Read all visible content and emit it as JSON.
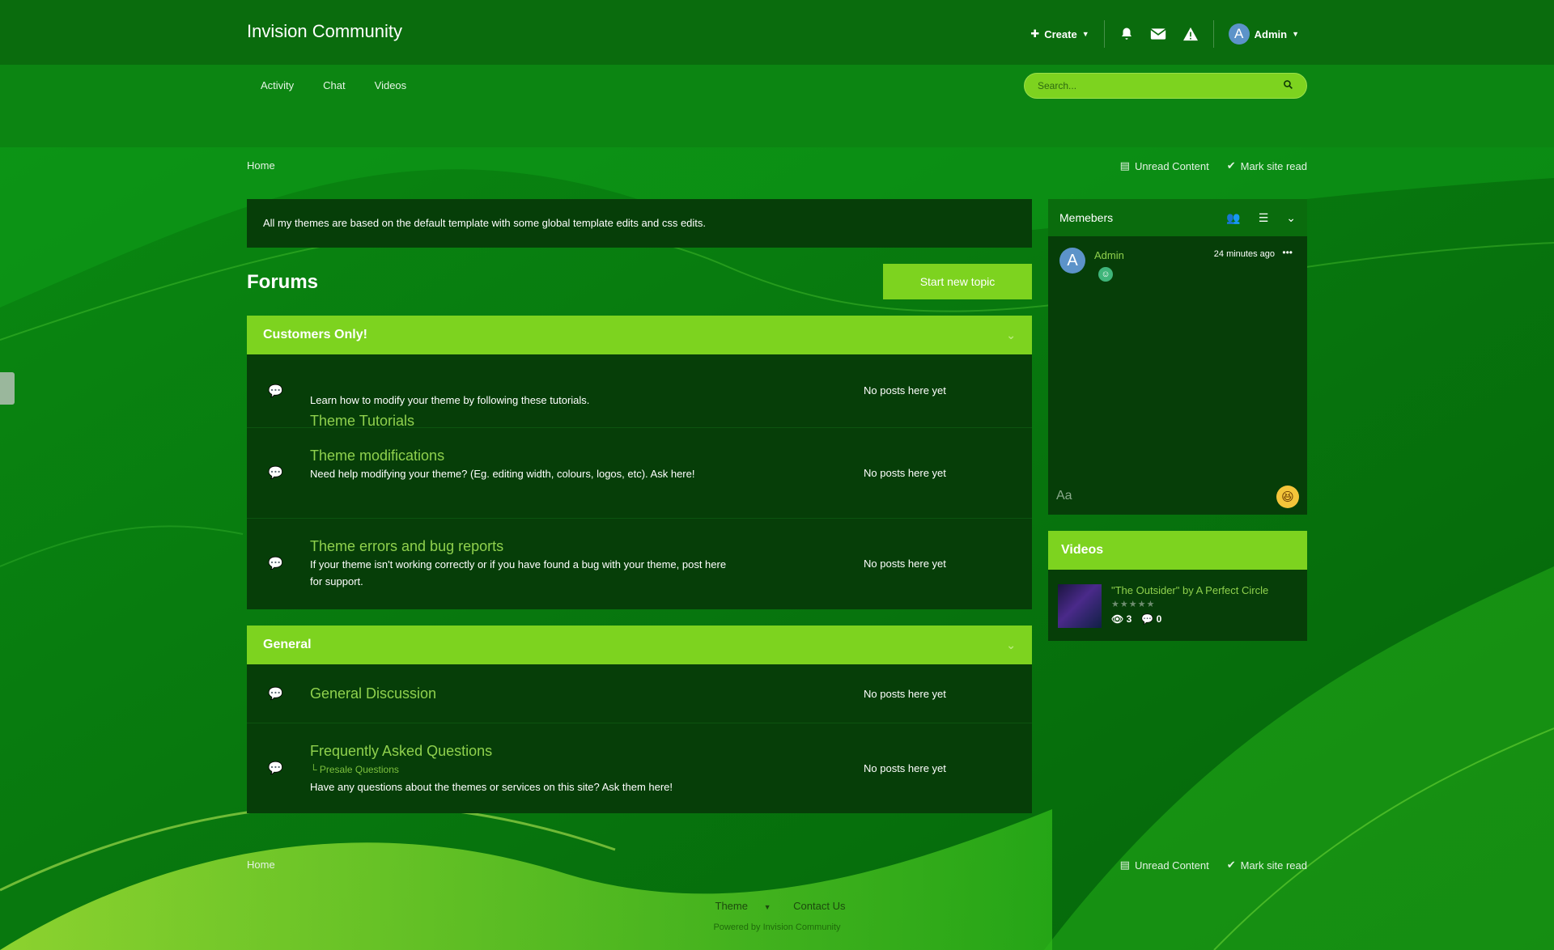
{
  "header": {
    "site_title": "Invision Community",
    "create_label": "Create",
    "user_name": "Admin",
    "avatar_letter": "A"
  },
  "nav": {
    "tabs": [
      {
        "label": "Activity"
      },
      {
        "label": "Chat"
      },
      {
        "label": "Videos"
      }
    ],
    "search_placeholder": "Search..."
  },
  "breadcrumb": {
    "home": "Home",
    "unread_content": "Unread Content",
    "mark_site_read": "Mark site read"
  },
  "announcement": "All my themes are based on the default template with some global template edits and css edits.",
  "main": {
    "page_title": "Forums",
    "start_topic_label": "Start new topic"
  },
  "categories": [
    {
      "name": "Customers Only!",
      "forums": [
        {
          "title": "Theme Tutorials",
          "desc": "Learn how to modify your theme by following these tutorials.",
          "last": "No posts here yet"
        },
        {
          "title": "Theme modifications",
          "desc": "Need help modifying your theme? (Eg. editing width, colours, logos, etc). Ask here!",
          "last": "No posts here yet"
        },
        {
          "title": "Theme errors and bug reports",
          "desc": "If your theme isn't working correctly or if you have found a bug with your theme, post here for support.",
          "last": "No posts here yet"
        }
      ]
    },
    {
      "name": "General",
      "forums": [
        {
          "title": "General Discussion",
          "last": "No posts here yet"
        },
        {
          "title": "Frequently Asked Questions",
          "sub": "Presale Questions",
          "desc": "Have any questions about the themes or services on this site? Ask them here!",
          "last": "No posts here yet"
        }
      ]
    }
  ],
  "sidebar": {
    "members_title": "Memebers",
    "member_name": "Admin",
    "member_avatar": "A",
    "member_time": "24 minutes ago",
    "chat_placeholder": "Aa",
    "videos_title": "Videos",
    "video_title": "\"The Outsider\" by A Perfect Circle",
    "video_views": "3",
    "video_comments": "0"
  },
  "footer": {
    "home": "Home",
    "unread_content": "Unread Content",
    "mark_site_read": "Mark site read",
    "theme_label": "Theme",
    "contact_label": "Contact Us",
    "powered": "Powered by Invision Community"
  },
  "colors": {
    "accent": "#7dd31f",
    "panel": "#063e08",
    "link": "#8fd14d"
  }
}
